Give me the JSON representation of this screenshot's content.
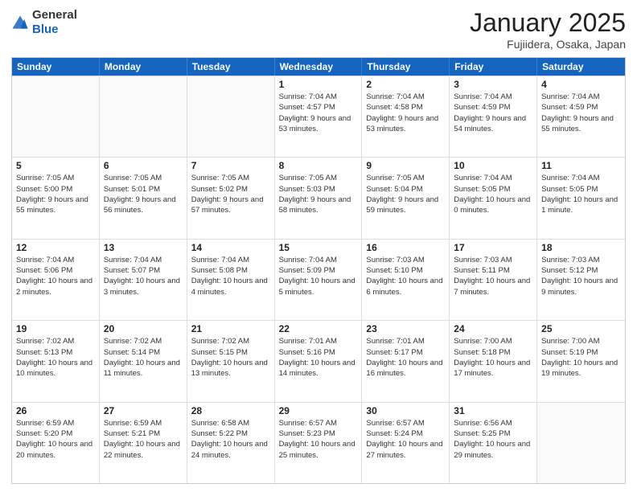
{
  "header": {
    "logo": {
      "line1": "General",
      "line2": "Blue"
    },
    "title": "January 2025",
    "subtitle": "Fujiidera, Osaka, Japan"
  },
  "days_of_week": [
    "Sunday",
    "Monday",
    "Tuesday",
    "Wednesday",
    "Thursday",
    "Friday",
    "Saturday"
  ],
  "weeks": [
    [
      {
        "day": "",
        "empty": true
      },
      {
        "day": "",
        "empty": true
      },
      {
        "day": "",
        "empty": true
      },
      {
        "day": "1",
        "sunrise": "7:04 AM",
        "sunset": "4:57 PM",
        "daylight": "9 hours and 53 minutes."
      },
      {
        "day": "2",
        "sunrise": "7:04 AM",
        "sunset": "4:58 PM",
        "daylight": "9 hours and 53 minutes."
      },
      {
        "day": "3",
        "sunrise": "7:04 AM",
        "sunset": "4:59 PM",
        "daylight": "9 hours and 54 minutes."
      },
      {
        "day": "4",
        "sunrise": "7:04 AM",
        "sunset": "4:59 PM",
        "daylight": "9 hours and 55 minutes."
      }
    ],
    [
      {
        "day": "5",
        "sunrise": "7:05 AM",
        "sunset": "5:00 PM",
        "daylight": "9 hours and 55 minutes."
      },
      {
        "day": "6",
        "sunrise": "7:05 AM",
        "sunset": "5:01 PM",
        "daylight": "9 hours and 56 minutes."
      },
      {
        "day": "7",
        "sunrise": "7:05 AM",
        "sunset": "5:02 PM",
        "daylight": "9 hours and 57 minutes."
      },
      {
        "day": "8",
        "sunrise": "7:05 AM",
        "sunset": "5:03 PM",
        "daylight": "9 hours and 58 minutes."
      },
      {
        "day": "9",
        "sunrise": "7:05 AM",
        "sunset": "5:04 PM",
        "daylight": "9 hours and 59 minutes."
      },
      {
        "day": "10",
        "sunrise": "7:04 AM",
        "sunset": "5:05 PM",
        "daylight": "10 hours and 0 minutes."
      },
      {
        "day": "11",
        "sunrise": "7:04 AM",
        "sunset": "5:05 PM",
        "daylight": "10 hours and 1 minute."
      }
    ],
    [
      {
        "day": "12",
        "sunrise": "7:04 AM",
        "sunset": "5:06 PM",
        "daylight": "10 hours and 2 minutes."
      },
      {
        "day": "13",
        "sunrise": "7:04 AM",
        "sunset": "5:07 PM",
        "daylight": "10 hours and 3 minutes."
      },
      {
        "day": "14",
        "sunrise": "7:04 AM",
        "sunset": "5:08 PM",
        "daylight": "10 hours and 4 minutes."
      },
      {
        "day": "15",
        "sunrise": "7:04 AM",
        "sunset": "5:09 PM",
        "daylight": "10 hours and 5 minutes."
      },
      {
        "day": "16",
        "sunrise": "7:03 AM",
        "sunset": "5:10 PM",
        "daylight": "10 hours and 6 minutes."
      },
      {
        "day": "17",
        "sunrise": "7:03 AM",
        "sunset": "5:11 PM",
        "daylight": "10 hours and 7 minutes."
      },
      {
        "day": "18",
        "sunrise": "7:03 AM",
        "sunset": "5:12 PM",
        "daylight": "10 hours and 9 minutes."
      }
    ],
    [
      {
        "day": "19",
        "sunrise": "7:02 AM",
        "sunset": "5:13 PM",
        "daylight": "10 hours and 10 minutes."
      },
      {
        "day": "20",
        "sunrise": "7:02 AM",
        "sunset": "5:14 PM",
        "daylight": "10 hours and 11 minutes."
      },
      {
        "day": "21",
        "sunrise": "7:02 AM",
        "sunset": "5:15 PM",
        "daylight": "10 hours and 13 minutes."
      },
      {
        "day": "22",
        "sunrise": "7:01 AM",
        "sunset": "5:16 PM",
        "daylight": "10 hours and 14 minutes."
      },
      {
        "day": "23",
        "sunrise": "7:01 AM",
        "sunset": "5:17 PM",
        "daylight": "10 hours and 16 minutes."
      },
      {
        "day": "24",
        "sunrise": "7:00 AM",
        "sunset": "5:18 PM",
        "daylight": "10 hours and 17 minutes."
      },
      {
        "day": "25",
        "sunrise": "7:00 AM",
        "sunset": "5:19 PM",
        "daylight": "10 hours and 19 minutes."
      }
    ],
    [
      {
        "day": "26",
        "sunrise": "6:59 AM",
        "sunset": "5:20 PM",
        "daylight": "10 hours and 20 minutes."
      },
      {
        "day": "27",
        "sunrise": "6:59 AM",
        "sunset": "5:21 PM",
        "daylight": "10 hours and 22 minutes."
      },
      {
        "day": "28",
        "sunrise": "6:58 AM",
        "sunset": "5:22 PM",
        "daylight": "10 hours and 24 minutes."
      },
      {
        "day": "29",
        "sunrise": "6:57 AM",
        "sunset": "5:23 PM",
        "daylight": "10 hours and 25 minutes."
      },
      {
        "day": "30",
        "sunrise": "6:57 AM",
        "sunset": "5:24 PM",
        "daylight": "10 hours and 27 minutes."
      },
      {
        "day": "31",
        "sunrise": "6:56 AM",
        "sunset": "5:25 PM",
        "daylight": "10 hours and 29 minutes."
      },
      {
        "day": "",
        "empty": true
      }
    ]
  ]
}
